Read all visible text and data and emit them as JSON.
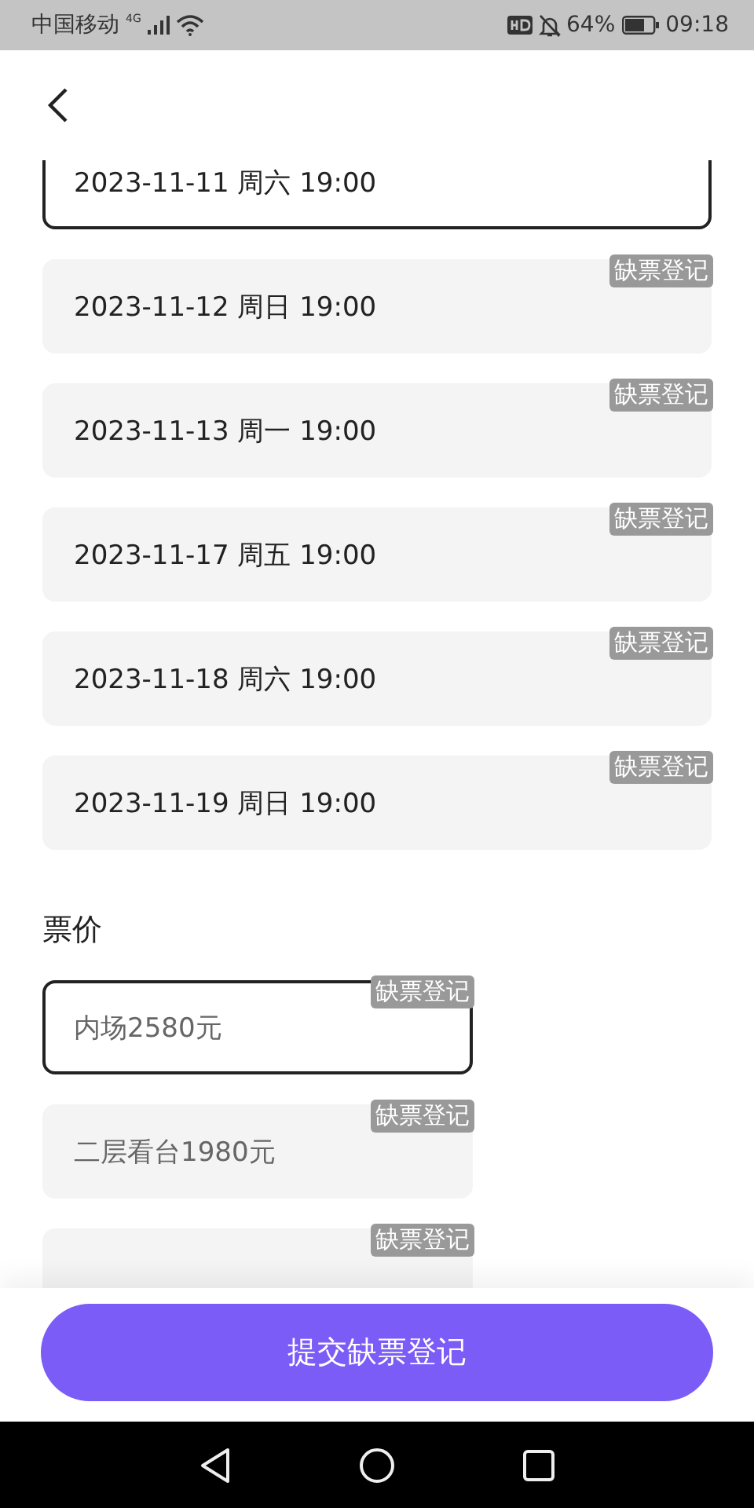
{
  "status_bar": {
    "carrier": "中国移动",
    "network": "4G",
    "battery": "64%",
    "time": "09:18"
  },
  "dates": [
    {
      "text": "2023-11-11 周六 19:00",
      "selected": true
    },
    {
      "text": "2023-11-12 周日 19:00",
      "selected": false,
      "tag": "缺票登记"
    },
    {
      "text": "2023-11-13 周一 19:00",
      "selected": false,
      "tag": "缺票登记"
    },
    {
      "text": "2023-11-17 周五 19:00",
      "selected": false,
      "tag": "缺票登记"
    },
    {
      "text": "2023-11-18 周六 19:00",
      "selected": false,
      "tag": "缺票登记"
    },
    {
      "text": "2023-11-19 周日 19:00",
      "selected": false,
      "tag": "缺票登记"
    }
  ],
  "price_heading": "票价",
  "prices": [
    {
      "text": "内场2580元",
      "selected": true,
      "tag": "缺票登记"
    },
    {
      "text": "二层看台1980元",
      "selected": false,
      "tag": "缺票登记"
    },
    {
      "selected": false,
      "tag": "缺票登记"
    }
  ],
  "submit_button": "提交缺票登记"
}
